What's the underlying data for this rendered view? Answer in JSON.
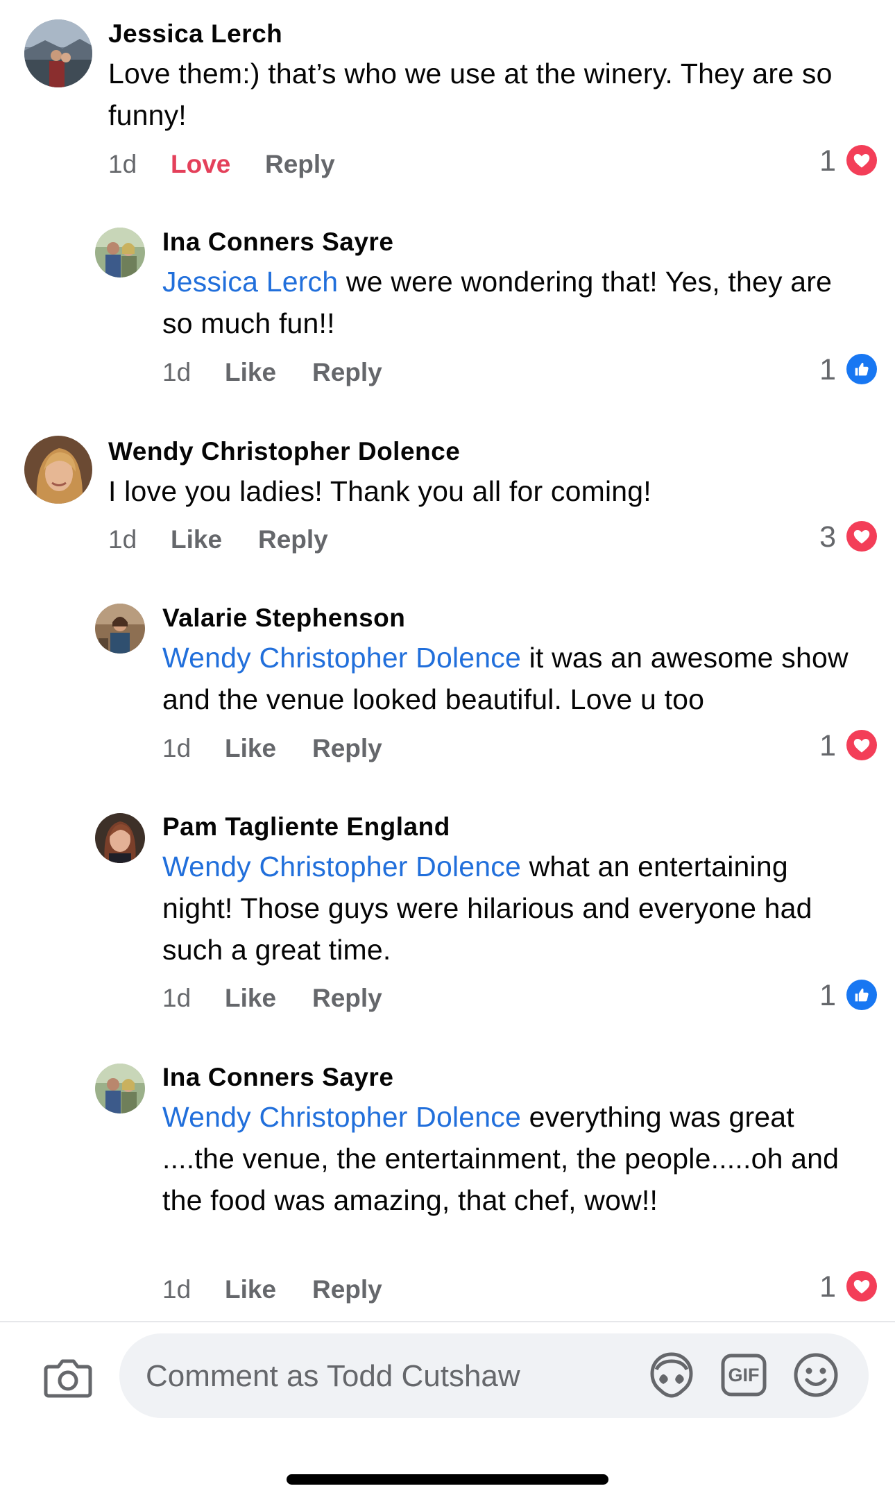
{
  "colors": {
    "mention": "#216fdb",
    "love": "#f33e58",
    "like": "#1877f2",
    "meta": "#65676b"
  },
  "comments": [
    {
      "author": "Jessica Lerch",
      "text": "Love them:) that’s who we use at the winery. They are so funny!",
      "time": "1d",
      "action_react": "Love",
      "action_reply": "Reply",
      "reaction_count": "1",
      "reaction_icon": "heart-icon"
    },
    {
      "author": "Ina Conners Sayre",
      "mention": "Jessica Lerch",
      "text": " we were wondering that!  Yes, they are so much fun!!",
      "time": "1d",
      "action_react": "Like",
      "action_reply": "Reply",
      "reaction_count": "1",
      "reaction_icon": "thumbs-up-icon"
    },
    {
      "author": "Wendy Christopher Dolence",
      "text": "I love you ladies! Thank you all for coming!",
      "time": "1d",
      "action_react": "Like",
      "action_reply": "Reply",
      "reaction_count": "3",
      "reaction_icon": "heart-icon"
    },
    {
      "author": "Valarie Stephenson",
      "mention": "Wendy Christopher Dolence",
      "text": " it was an awesome show and the venue looked beautiful. Love u too",
      "time": "1d",
      "action_react": "Like",
      "action_reply": "Reply",
      "reaction_count": "1",
      "reaction_icon": "heart-icon"
    },
    {
      "author": "Pam Tagliente England",
      "mention": "Wendy Christopher Dolence",
      "text": " what an entertaining night!  Those guys were hilarious and everyone had such a great time.",
      "time": "1d",
      "action_react": "Like",
      "action_reply": "Reply",
      "reaction_count": "1",
      "reaction_icon": "thumbs-up-icon"
    },
    {
      "author": "Ina Conners Sayre",
      "mention": "Wendy Christopher Dolence",
      "text": " everything was great ....the venue, the entertainment, the people.....oh and the food was amazing, that chef, wow!!",
      "time": "1d",
      "action_react": "Like",
      "action_reply": "Reply",
      "reaction_count": "1",
      "reaction_icon": "heart-icon"
    }
  ],
  "composer": {
    "placeholder": "Comment as Todd Cutshaw",
    "camera_icon": "camera-icon",
    "avatar_sticker_icon": "avatar-sticker-icon",
    "gif_label": "GIF",
    "emoji_icon": "emoji-icon"
  }
}
